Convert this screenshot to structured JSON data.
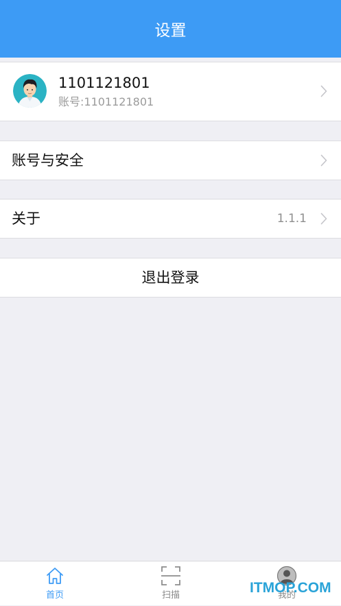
{
  "header": {
    "title": "设置"
  },
  "profile": {
    "name": "1101121801",
    "account": "账号:1101121801"
  },
  "menu": {
    "security_label": "账号与安全",
    "about_label": "关于",
    "about_version": "1.1.1",
    "logout_label": "退出登录"
  },
  "tabbar": {
    "items": [
      {
        "label": "首页",
        "icon": "home-icon",
        "active": true
      },
      {
        "label": "扫描",
        "icon": "scan-icon",
        "active": false
      },
      {
        "label": "我的",
        "icon": "user-icon",
        "active": false
      }
    ]
  },
  "watermark": {
    "text": "ITMOP.COM"
  },
  "colors": {
    "accent": "#3d9bf5",
    "background": "#efeff4",
    "watermark": "#2aa3d8"
  }
}
